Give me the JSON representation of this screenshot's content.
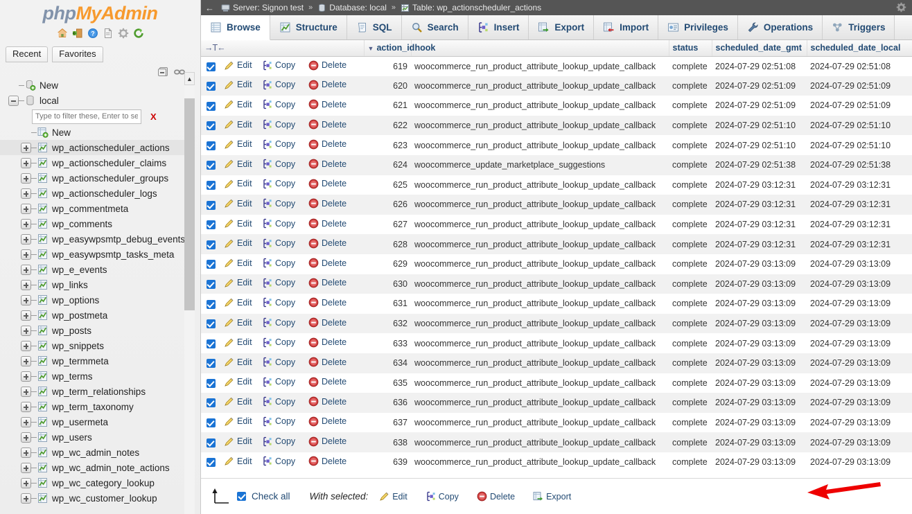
{
  "app": {
    "brand_php": "php",
    "brand_myadmin": "MyAdmin",
    "logo_icons": [
      "home-icon",
      "logout-icon",
      "help-icon",
      "docs-icon",
      "settings-icon",
      "refresh-icon"
    ]
  },
  "sidebar": {
    "tabs": [
      {
        "label": "Recent",
        "name": "recent-tab"
      },
      {
        "label": "Favorites",
        "name": "favorites-tab"
      }
    ],
    "controls": [
      "collapse-all-icon",
      "link-icon"
    ],
    "tree": [
      {
        "label": "New",
        "type": "new-db",
        "indent": 0,
        "expander": "none",
        "selected": false
      },
      {
        "label": "local",
        "type": "database",
        "indent": 0,
        "expander": "minus",
        "selected": false
      },
      {
        "label": "New",
        "type": "new-table",
        "indent": 1,
        "expander": "none",
        "selected": false
      },
      {
        "label": "wp_actionscheduler_actions",
        "type": "table",
        "indent": 1,
        "expander": "plus",
        "selected": true
      },
      {
        "label": "wp_actionscheduler_claims",
        "type": "table",
        "indent": 1,
        "expander": "plus",
        "selected": false
      },
      {
        "label": "wp_actionscheduler_groups",
        "type": "table",
        "indent": 1,
        "expander": "plus",
        "selected": false
      },
      {
        "label": "wp_actionscheduler_logs",
        "type": "table",
        "indent": 1,
        "expander": "plus",
        "selected": false
      },
      {
        "label": "wp_commentmeta",
        "type": "table",
        "indent": 1,
        "expander": "plus",
        "selected": false
      },
      {
        "label": "wp_comments",
        "type": "table",
        "indent": 1,
        "expander": "plus",
        "selected": false
      },
      {
        "label": "wp_easywpsmtp_debug_events",
        "type": "table",
        "indent": 1,
        "expander": "plus",
        "selected": false
      },
      {
        "label": "wp_easywpsmtp_tasks_meta",
        "type": "table",
        "indent": 1,
        "expander": "plus",
        "selected": false
      },
      {
        "label": "wp_e_events",
        "type": "table",
        "indent": 1,
        "expander": "plus",
        "selected": false
      },
      {
        "label": "wp_links",
        "type": "table",
        "indent": 1,
        "expander": "plus",
        "selected": false
      },
      {
        "label": "wp_options",
        "type": "table",
        "indent": 1,
        "expander": "plus",
        "selected": false
      },
      {
        "label": "wp_postmeta",
        "type": "table",
        "indent": 1,
        "expander": "plus",
        "selected": false
      },
      {
        "label": "wp_posts",
        "type": "table",
        "indent": 1,
        "expander": "plus",
        "selected": false
      },
      {
        "label": "wp_snippets",
        "type": "table",
        "indent": 1,
        "expander": "plus",
        "selected": false
      },
      {
        "label": "wp_termmeta",
        "type": "table",
        "indent": 1,
        "expander": "plus",
        "selected": false
      },
      {
        "label": "wp_terms",
        "type": "table",
        "indent": 1,
        "expander": "plus",
        "selected": false
      },
      {
        "label": "wp_term_relationships",
        "type": "table",
        "indent": 1,
        "expander": "plus",
        "selected": false
      },
      {
        "label": "wp_term_taxonomy",
        "type": "table",
        "indent": 1,
        "expander": "plus",
        "selected": false
      },
      {
        "label": "wp_usermeta",
        "type": "table",
        "indent": 1,
        "expander": "plus",
        "selected": false
      },
      {
        "label": "wp_users",
        "type": "table",
        "indent": 1,
        "expander": "plus",
        "selected": false
      },
      {
        "label": "wp_wc_admin_notes",
        "type": "table",
        "indent": 1,
        "expander": "plus",
        "selected": false
      },
      {
        "label": "wp_wc_admin_note_actions",
        "type": "table",
        "indent": 1,
        "expander": "plus",
        "selected": false
      },
      {
        "label": "wp_wc_category_lookup",
        "type": "table",
        "indent": 1,
        "expander": "plus",
        "selected": false
      },
      {
        "label": "wp_wc_customer_lookup",
        "type": "table",
        "indent": 1,
        "expander": "plus",
        "selected": false
      }
    ],
    "filter": {
      "placeholder": "Type to filter these, Enter to search",
      "value": "",
      "clear_label": "X"
    }
  },
  "breadcrumb": {
    "back_glyph": "←",
    "server_label": "Server: Signon test",
    "database_label": "Database: local",
    "table_label": "Table: wp_actionscheduler_actions",
    "separator": "»",
    "gear": "gear-icon"
  },
  "tabs": [
    {
      "label": "Browse",
      "icon": "browse-icon",
      "active": true
    },
    {
      "label": "Structure",
      "icon": "structure-icon",
      "active": false
    },
    {
      "label": "SQL",
      "icon": "sql-icon",
      "active": false
    },
    {
      "label": "Search",
      "icon": "search-icon",
      "active": false
    },
    {
      "label": "Insert",
      "icon": "insert-icon",
      "active": false
    },
    {
      "label": "Export",
      "icon": "export-icon",
      "active": false
    },
    {
      "label": "Import",
      "icon": "import-icon",
      "active": false
    },
    {
      "label": "Privileges",
      "icon": "privileges-icon",
      "active": false
    },
    {
      "label": "Operations",
      "icon": "operations-icon",
      "active": false
    },
    {
      "label": "Triggers",
      "icon": "triggers-icon",
      "active": false
    }
  ],
  "table": {
    "sort_toggle": "▼",
    "columns": [
      "action_id",
      "hook",
      "status",
      "scheduled_date_gmt",
      "scheduled_date_local"
    ],
    "row_actions": [
      {
        "label": "Edit",
        "icon": "pencil-icon"
      },
      {
        "label": "Copy",
        "icon": "copy-icon"
      },
      {
        "label": "Delete",
        "icon": "delete-icon"
      }
    ],
    "rows": [
      {
        "checked": true,
        "action_id": "619",
        "hook": "woocommerce_run_product_attribute_lookup_update_callback",
        "status": "complete",
        "scheduled_date_gmt": "2024-07-29 02:51:08",
        "scheduled_date_local": "2024-07-29 02:51:08"
      },
      {
        "checked": true,
        "action_id": "620",
        "hook": "woocommerce_run_product_attribute_lookup_update_callback",
        "status": "complete",
        "scheduled_date_gmt": "2024-07-29 02:51:09",
        "scheduled_date_local": "2024-07-29 02:51:09"
      },
      {
        "checked": true,
        "action_id": "621",
        "hook": "woocommerce_run_product_attribute_lookup_update_callback",
        "status": "complete",
        "scheduled_date_gmt": "2024-07-29 02:51:09",
        "scheduled_date_local": "2024-07-29 02:51:09"
      },
      {
        "checked": true,
        "action_id": "622",
        "hook": "woocommerce_run_product_attribute_lookup_update_callback",
        "status": "complete",
        "scheduled_date_gmt": "2024-07-29 02:51:10",
        "scheduled_date_local": "2024-07-29 02:51:10"
      },
      {
        "checked": true,
        "action_id": "623",
        "hook": "woocommerce_run_product_attribute_lookup_update_callback",
        "status": "complete",
        "scheduled_date_gmt": "2024-07-29 02:51:10",
        "scheduled_date_local": "2024-07-29 02:51:10"
      },
      {
        "checked": true,
        "action_id": "624",
        "hook": "woocommerce_update_marketplace_suggestions",
        "status": "complete",
        "scheduled_date_gmt": "2024-07-29 02:51:38",
        "scheduled_date_local": "2024-07-29 02:51:38"
      },
      {
        "checked": true,
        "action_id": "625",
        "hook": "woocommerce_run_product_attribute_lookup_update_callback",
        "status": "complete",
        "scheduled_date_gmt": "2024-07-29 03:12:31",
        "scheduled_date_local": "2024-07-29 03:12:31"
      },
      {
        "checked": true,
        "action_id": "626",
        "hook": "woocommerce_run_product_attribute_lookup_update_callback",
        "status": "complete",
        "scheduled_date_gmt": "2024-07-29 03:12:31",
        "scheduled_date_local": "2024-07-29 03:12:31"
      },
      {
        "checked": true,
        "action_id": "627",
        "hook": "woocommerce_run_product_attribute_lookup_update_callback",
        "status": "complete",
        "scheduled_date_gmt": "2024-07-29 03:12:31",
        "scheduled_date_local": "2024-07-29 03:12:31"
      },
      {
        "checked": true,
        "action_id": "628",
        "hook": "woocommerce_run_product_attribute_lookup_update_callback",
        "status": "complete",
        "scheduled_date_gmt": "2024-07-29 03:12:31",
        "scheduled_date_local": "2024-07-29 03:12:31"
      },
      {
        "checked": true,
        "action_id": "629",
        "hook": "woocommerce_run_product_attribute_lookup_update_callback",
        "status": "complete",
        "scheduled_date_gmt": "2024-07-29 03:13:09",
        "scheduled_date_local": "2024-07-29 03:13:09"
      },
      {
        "checked": true,
        "action_id": "630",
        "hook": "woocommerce_run_product_attribute_lookup_update_callback",
        "status": "complete",
        "scheduled_date_gmt": "2024-07-29 03:13:09",
        "scheduled_date_local": "2024-07-29 03:13:09"
      },
      {
        "checked": true,
        "action_id": "631",
        "hook": "woocommerce_run_product_attribute_lookup_update_callback",
        "status": "complete",
        "scheduled_date_gmt": "2024-07-29 03:13:09",
        "scheduled_date_local": "2024-07-29 03:13:09"
      },
      {
        "checked": true,
        "action_id": "632",
        "hook": "woocommerce_run_product_attribute_lookup_update_callback",
        "status": "complete",
        "scheduled_date_gmt": "2024-07-29 03:13:09",
        "scheduled_date_local": "2024-07-29 03:13:09"
      },
      {
        "checked": true,
        "action_id": "633",
        "hook": "woocommerce_run_product_attribute_lookup_update_callback",
        "status": "complete",
        "scheduled_date_gmt": "2024-07-29 03:13:09",
        "scheduled_date_local": "2024-07-29 03:13:09"
      },
      {
        "checked": true,
        "action_id": "634",
        "hook": "woocommerce_run_product_attribute_lookup_update_callback",
        "status": "complete",
        "scheduled_date_gmt": "2024-07-29 03:13:09",
        "scheduled_date_local": "2024-07-29 03:13:09"
      },
      {
        "checked": true,
        "action_id": "635",
        "hook": "woocommerce_run_product_attribute_lookup_update_callback",
        "status": "complete",
        "scheduled_date_gmt": "2024-07-29 03:13:09",
        "scheduled_date_local": "2024-07-29 03:13:09"
      },
      {
        "checked": true,
        "action_id": "636",
        "hook": "woocommerce_run_product_attribute_lookup_update_callback",
        "status": "complete",
        "scheduled_date_gmt": "2024-07-29 03:13:09",
        "scheduled_date_local": "2024-07-29 03:13:09"
      },
      {
        "checked": true,
        "action_id": "637",
        "hook": "woocommerce_run_product_attribute_lookup_update_callback",
        "status": "complete",
        "scheduled_date_gmt": "2024-07-29 03:13:09",
        "scheduled_date_local": "2024-07-29 03:13:09"
      },
      {
        "checked": true,
        "action_id": "638",
        "hook": "woocommerce_run_product_attribute_lookup_update_callback",
        "status": "complete",
        "scheduled_date_gmt": "2024-07-29 03:13:09",
        "scheduled_date_local": "2024-07-29 03:13:09"
      },
      {
        "checked": true,
        "action_id": "639",
        "hook": "woocommerce_run_product_attribute_lookup_update_callback",
        "status": "complete",
        "scheduled_date_gmt": "2024-07-29 03:13:09",
        "scheduled_date_local": "2024-07-29 03:13:09"
      }
    ]
  },
  "footer": {
    "check_all_label": "Check all",
    "check_all_checked": true,
    "with_selected_label": "With selected:",
    "actions": [
      {
        "label": "Edit",
        "icon": "pencil-icon"
      },
      {
        "label": "Copy",
        "icon": "copy-icon"
      },
      {
        "label": "Delete",
        "icon": "delete-icon"
      },
      {
        "label": "Export",
        "icon": "export-icon"
      }
    ]
  },
  "annotation": {
    "arrow_color": "#ee0000",
    "points_to": "Export"
  },
  "colors": {
    "link": "#224a73",
    "checkbox": "#1a73d4",
    "breadcrumb_bg": "#555555",
    "brand_orange": "#f79a2e",
    "brand_gray": "#8293ab",
    "row_alt": "#f1f1f1"
  }
}
